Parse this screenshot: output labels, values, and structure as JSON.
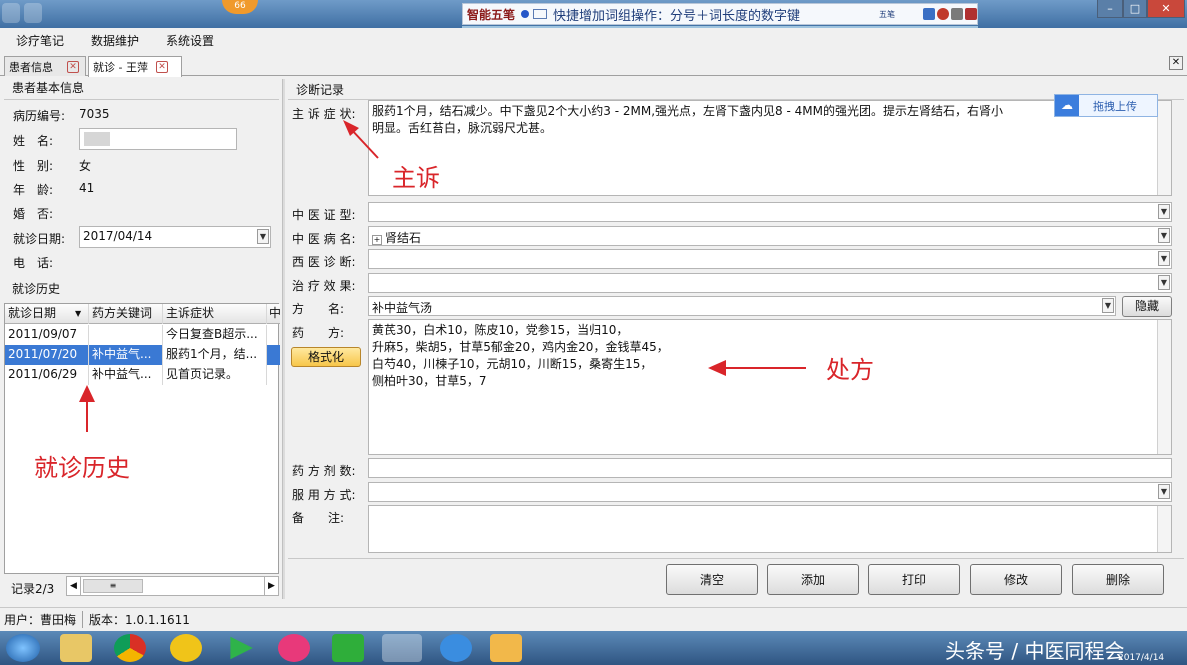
{
  "ime": {
    "logo": "智能五笔",
    "tip": "快捷增加词组操作：分号＋词长度的数字键",
    "mode": "五笔"
  },
  "menu": [
    "诊疗笔记",
    "数据维护",
    "系统设置"
  ],
  "tabs": [
    {
      "label": "患者信息"
    },
    {
      "label": "就诊 - 王萍"
    }
  ],
  "patient": {
    "header": "患者基本信息",
    "id_label": "病历编号:",
    "id_value": "7035",
    "name_label": "姓　名:",
    "name_value": "",
    "sex_label": "性　别:",
    "sex_value": "女",
    "age_label": "年　龄:",
    "age_value": "41",
    "married_label": "婚　否:",
    "married_value": "",
    "date_label": "就诊日期:",
    "date_value": "2017/04/14",
    "phone_label": "电　话:",
    "phone_value": ""
  },
  "history": {
    "header": "就诊历史",
    "columns": [
      "就诊日期",
      "药方关键词",
      "主诉症状",
      "中"
    ],
    "rows": [
      {
        "date": "2011/09/07",
        "keyword": "",
        "symptom": "今日复查B超示..."
      },
      {
        "date": "2011/07/20",
        "keyword": "补中益气...",
        "symptom": "服药1个月，结..."
      },
      {
        "date": "2011/06/29",
        "keyword": "补中益气...",
        "symptom": "见首页记录。"
      }
    ],
    "record": "记录2/3"
  },
  "diag": {
    "header": "诊断记录",
    "complaint_label": "主 诉 症 状:",
    "complaint_line1": "服药1个月，结石减少。中下盏见2个大小约3 - 2MM,强光点，左肾下盏内见8 - 4MM的强光团。提示左肾结石，右肾小",
    "complaint_line2": "明显。舌红苔白，脉沉弱尺尤甚。",
    "syndrome_label": "中 医 证 型:",
    "syndrome_value": "",
    "disease_label": "中 医 病 名:",
    "disease_value": "肾结石",
    "western_label": "西 医 诊 断:",
    "western_value": "",
    "effect_label": "治 疗 效 果:",
    "effect_value": "",
    "formula_label": "方　　名:",
    "formula_value": "补中益气汤",
    "hide_button": "隐藏",
    "herbs_label": "药　　方:",
    "format_button": "格式化",
    "herbs_lines": [
      "黄芪30，白术10，陈皮10，党参15，当归10，",
      "升麻5，柴胡5，甘草5郁金20，鸡内金20，金钱草45，",
      "白芍40，川楝子10，元胡10，川断15，桑寄生15，",
      "侧柏叶30，甘草5，7"
    ],
    "dose_label": "药 方 剂 数:",
    "dose_value": "",
    "usage_label": "服 用 方 式:",
    "usage_value": "",
    "note_label": "备　　注:",
    "note_value": ""
  },
  "upload": "拖拽上传",
  "actions": [
    "清空",
    "添加",
    "打印",
    "修改",
    "删除"
  ],
  "status": {
    "user": "用户：曹田梅",
    "version": "版本：1.0.1.1611"
  },
  "annotations": {
    "complaint": "主诉",
    "prescription": "处方",
    "history": "就诊历史"
  },
  "watermark": "头条号 / 中医同程会",
  "clock_date": "2017/4/14",
  "badge": "66",
  "colors": {
    "annotation": "#d9252a",
    "selected_row": "#3a79d4",
    "titlebar": "#3f6fa3",
    "taskbar": "#2f5582"
  }
}
